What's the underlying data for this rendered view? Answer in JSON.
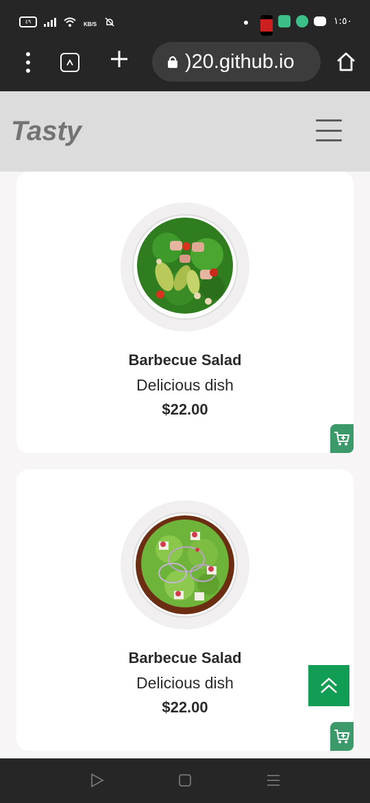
{
  "status_bar": {
    "battery_label": "٤٩",
    "network_speed": "KB/S",
    "time": "١:٥٠",
    "app_icon_colors": [
      "#cc1f1f",
      "#3dbf8a",
      "#3dbf8a",
      "#ffffff"
    ]
  },
  "browser": {
    "url_text": ")20.github.io",
    "icons": [
      "more-vert-icon",
      "tab-switcher-icon",
      "new-tab-plus-icon",
      "lock-icon",
      "home-icon"
    ]
  },
  "site": {
    "logo": "Tasty",
    "menu_icon": "hamburger-menu-icon"
  },
  "products": [
    {
      "name": "Barbecue Salad",
      "description": "Delicious dish",
      "price": "$22.00",
      "image": "chicken-avocado-salad"
    },
    {
      "name": "Barbecue Salad",
      "description": "Delicious dish",
      "price": "$22.00",
      "image": "greek-salad"
    }
  ],
  "colors": {
    "accent_green": "#129d55",
    "cart_green": "#3c9a6a",
    "header_bg": "#dcdcdc",
    "logo_color": "#737373"
  },
  "system_nav": {
    "icons": [
      "back-triangle-icon",
      "home-square-icon",
      "recents-menu-icon"
    ]
  }
}
